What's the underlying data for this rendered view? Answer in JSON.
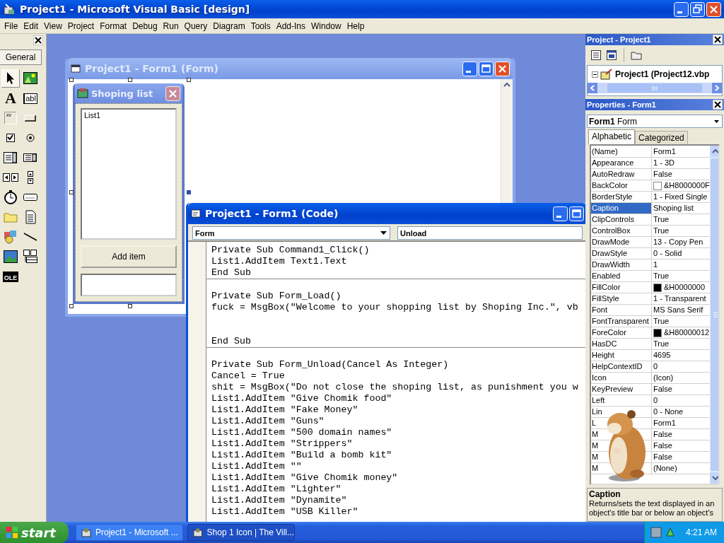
{
  "window": {
    "title": "Project1 - Microsoft Visual Basic [design]"
  },
  "menu": [
    "File",
    "Edit",
    "View",
    "Project",
    "Format",
    "Debug",
    "Run",
    "Query",
    "Diagram",
    "Tools",
    "Add-Ins",
    "Window",
    "Help"
  ],
  "toolbox": {
    "tab": "General",
    "tools": [
      {
        "kind": "pointer",
        "selected": true
      },
      {
        "kind": "picture",
        "selected": false
      },
      {
        "kind": "label",
        "glyph": "A",
        "selected": false
      },
      {
        "kind": "textbox",
        "glyph": "abl",
        "selected": false
      },
      {
        "kind": "frame",
        "glyph": "xv",
        "selected": false
      },
      {
        "kind": "command",
        "selected": false
      },
      {
        "kind": "checkbox",
        "selected": false
      },
      {
        "kind": "option",
        "selected": false
      },
      {
        "kind": "combo",
        "selected": false
      },
      {
        "kind": "list",
        "selected": false
      },
      {
        "kind": "hscroll",
        "selected": false
      },
      {
        "kind": "vscroll",
        "selected": false
      },
      {
        "kind": "timer",
        "selected": false
      },
      {
        "kind": "drive",
        "selected": false
      },
      {
        "kind": "folder",
        "selected": false
      },
      {
        "kind": "file",
        "selected": false
      },
      {
        "kind": "shape",
        "selected": false
      },
      {
        "kind": "line",
        "selected": false
      },
      {
        "kind": "image",
        "selected": false
      },
      {
        "kind": "data",
        "selected": false
      },
      {
        "kind": "ole",
        "glyph": "OLE",
        "selected": false
      }
    ]
  },
  "designer": {
    "title": "Project1 - Form1 (Form)",
    "active": false,
    "form": {
      "title": "Shoping list",
      "list_item": "List1",
      "button": "Add item"
    }
  },
  "code_window": {
    "title": "Project1 - Form1 (Code)",
    "active": true,
    "object": "Form",
    "procedure": "Unload",
    "procedures": [
      {
        "lines": [
          "Private Sub Command1_Click()",
          "List1.AddItem Text1.Text",
          "End Sub"
        ]
      },
      {
        "lines": [
          "Private Sub Form_Load()",
          "fuck = MsgBox(\"Welcome to your shopping list by Shoping Inc.\", vb"
        ],
        "blank_lines_before_end": true,
        "end": "End Sub"
      },
      {
        "lines": [
          "Private Sub Form_Unload(Cancel As Integer)",
          "Cancel = True",
          "shit = MsgBox(\"Do not close the shoping list, as punishment you w",
          "List1.AddItem \"Give Chomik food\"",
          "List1.AddItem \"Fake Money\"",
          "List1.AddItem \"Guns\"",
          "List1.AddItem \"500 domain names\"",
          "List1.AddItem \"Strippers\"",
          "List1.AddItem \"Build a bomb kit\"",
          "List1.AddItem \"\"",
          "List1.AddItem \"Give Chomik money\"",
          "List1.AddItem \"Lighter\"",
          "List1.AddItem \"Dynamite\"",
          "List1.AddItem \"USB Killer\""
        ]
      }
    ]
  },
  "project": {
    "title": "Project - Project1",
    "tree": [
      {
        "label": "Project1 (Project12.vbp",
        "expanded": true
      }
    ]
  },
  "properties": {
    "title": "Properties - Form1",
    "object_name": "Form1",
    "object_type": "Form",
    "tabs": [
      {
        "label": "Alphabetic",
        "selected": true
      },
      {
        "label": "Categorized",
        "selected": false
      }
    ],
    "rows": [
      {
        "name": "(Name)",
        "value": "Form1",
        "selected": false
      },
      {
        "name": "Appearance",
        "value": "1 - 3D",
        "selected": false
      },
      {
        "name": "AutoRedraw",
        "value": "False",
        "selected": false
      },
      {
        "name": "BackColor",
        "value": "&H8000000F",
        "color": "#ffffff",
        "selected": false
      },
      {
        "name": "BorderStyle",
        "value": "1 - Fixed Single",
        "selected": false
      },
      {
        "name": "Caption",
        "value": "Shoping list",
        "selected": true
      },
      {
        "name": "ClipControls",
        "value": "True",
        "selected": false
      },
      {
        "name": "ControlBox",
        "value": "True",
        "selected": false
      },
      {
        "name": "DrawMode",
        "value": "13 - Copy Pen",
        "selected": false
      },
      {
        "name": "DrawStyle",
        "value": "0 - Solid",
        "selected": false
      },
      {
        "name": "DrawWidth",
        "value": "1",
        "selected": false
      },
      {
        "name": "Enabled",
        "value": "True",
        "selected": false
      },
      {
        "name": "FillColor",
        "value": "&H0000000",
        "color": "#000000",
        "selected": false
      },
      {
        "name": "FillStyle",
        "value": "1 - Transparent",
        "selected": false
      },
      {
        "name": "Font",
        "value": "MS Sans Serif",
        "selected": false
      },
      {
        "name": "FontTransparent",
        "value": "True",
        "selected": false
      },
      {
        "name": "ForeColor",
        "value": "&H80000012",
        "color": "#000000",
        "selected": false
      },
      {
        "name": "HasDC",
        "value": "True",
        "selected": false
      },
      {
        "name": "Height",
        "value": "4695",
        "selected": false
      },
      {
        "name": "HelpContextID",
        "value": "0",
        "selected": false
      },
      {
        "name": "Icon",
        "value": "(Icon)",
        "selected": false
      },
      {
        "name": "KeyPreview",
        "value": "False",
        "selected": false
      },
      {
        "name": "Left",
        "value": "0",
        "selected": false
      },
      {
        "name": "Lin",
        "value": "0 - None",
        "selected": false
      },
      {
        "name": "L",
        "value": "Form1",
        "selected": false
      },
      {
        "name": "M",
        "value": "False",
        "selected": false
      },
      {
        "name": "M",
        "value": "False",
        "selected": false
      },
      {
        "name": "M",
        "value": "False",
        "selected": false
      },
      {
        "name": "M",
        "value": "(None)",
        "selected": false
      }
    ],
    "description": {
      "title": "Caption",
      "text": "Returns/sets the text displayed in an object's title bar or below an object's"
    }
  },
  "taskbar": {
    "start": "start",
    "tasks": [
      {
        "label": "Project1 - Microsoft ...",
        "selected": false
      },
      {
        "label": "Shop 1 Icon | The Vill...",
        "selected": true
      }
    ],
    "clock": "4:21 AM"
  }
}
